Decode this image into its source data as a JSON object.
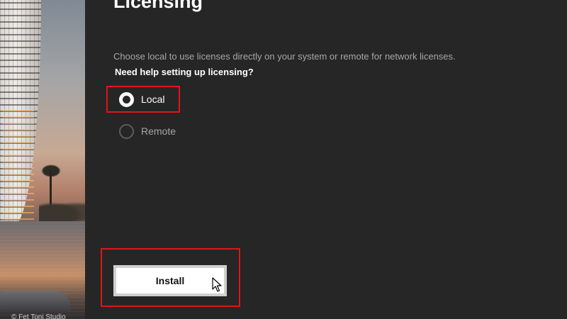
{
  "side_image": {
    "credit": "© Fet Toni Studio"
  },
  "main": {
    "title": "Licensing",
    "description": "Choose local to use licenses directly on your system or remote for network licenses.",
    "help_link": "Need help setting up licensing?",
    "options": [
      {
        "label": "Local",
        "selected": true
      },
      {
        "label": "Remote",
        "selected": false
      }
    ],
    "install_label": "Install"
  },
  "colors": {
    "background": "#262626",
    "highlight": "#e0141b",
    "button": "#ffffff",
    "muted_text": "#a7a7a7"
  },
  "icons": {
    "cursor": "arrow-pointer-icon",
    "radio_selected": "radio-checked-icon",
    "radio_unselected": "radio-unchecked-icon"
  }
}
